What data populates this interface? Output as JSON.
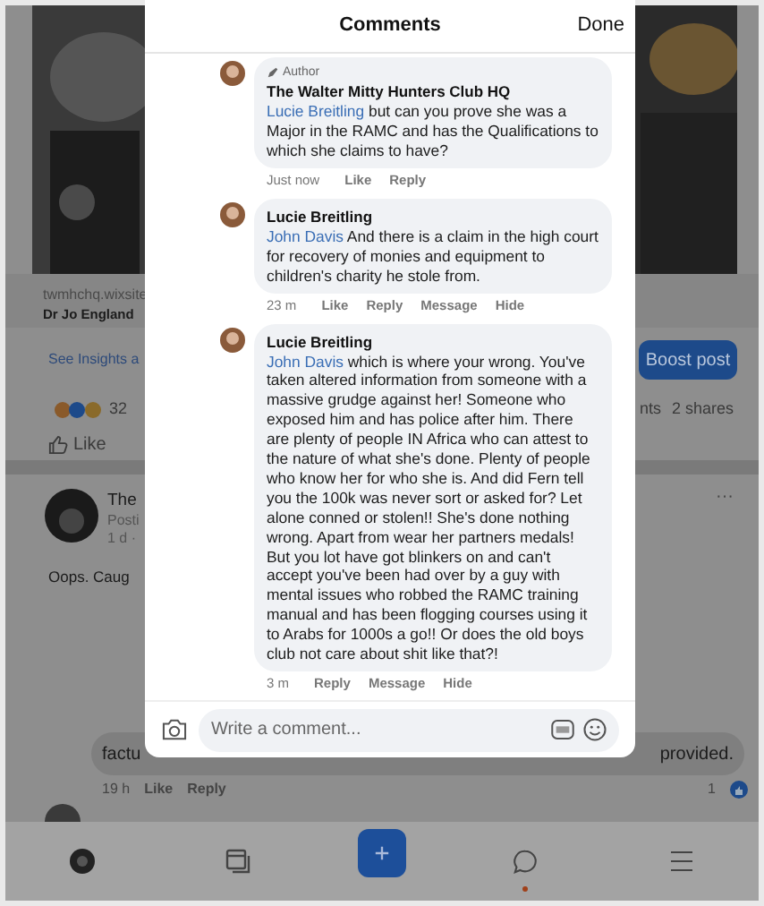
{
  "background_post": {
    "link": "twmhchq.wixsite",
    "title": "Dr Jo England",
    "insights": "See Insights a",
    "boost": "Boost post",
    "reaction_count": "32",
    "comments_count": "nts",
    "shares": "2 shares",
    "like": "Like"
  },
  "background_post2": {
    "author": "The",
    "meta": "Posti",
    "time": "1 d ·",
    "text": "Oops. Caug",
    "more": "···"
  },
  "background_comment": {
    "text_left": "factu",
    "text_right": "provided.",
    "time": "19 h",
    "like": "Like",
    "reply": "Reply",
    "likes": "1"
  },
  "modal": {
    "title": "Comments",
    "done": "Done",
    "comments": [
      {
        "author_badge": "Author",
        "name": "The Walter Mitty Hunters Club HQ",
        "mention": "Lucie Breitling",
        "text": "but can you prove she was a Major in the RAMC and has the Qualifications to which she claims to have?",
        "time": "Just now",
        "actions": [
          "Like",
          "Reply"
        ]
      },
      {
        "name": "Lucie Breitling",
        "mention": "John Davis",
        "text": "And there is a claim in the high court for recovery of monies and equipment to children's charity he stole from.",
        "time": "23 m",
        "actions": [
          "Like",
          "Reply",
          "Message",
          "Hide"
        ]
      },
      {
        "name": "Lucie Breitling",
        "mention": "John Davis",
        "text": "which is where your wrong. You've taken altered information from someone with a massive grudge against her! Someone who exposed him and has police after him. There are plenty of people IN Africa who can attest to the nature of what she's done. Plenty of people who know her for who she is. And did Fern tell you the 100k was never sort or asked for? Let alone conned or stolen!! She's done nothing wrong. Apart from wear her partners medals!  But you lot have got blinkers on and can't accept you've been had over by a guy with mental issues who robbed the RAMC training manual and has been flogging courses using it to Arabs for 1000s a go!! Or does the old boys club not care about shit like that?!",
        "time": "3 m",
        "actions": [
          "Reply",
          "Message",
          "Hide"
        ]
      }
    ],
    "composer": {
      "placeholder": "Write a comment..."
    }
  },
  "nav": [
    {
      "kind": "avatar",
      "dot": false
    },
    {
      "kind": "pages",
      "dot": false
    },
    {
      "kind": "create",
      "dot": false
    },
    {
      "kind": "messages",
      "dot": true
    },
    {
      "kind": "menu",
      "dot": false
    }
  ]
}
